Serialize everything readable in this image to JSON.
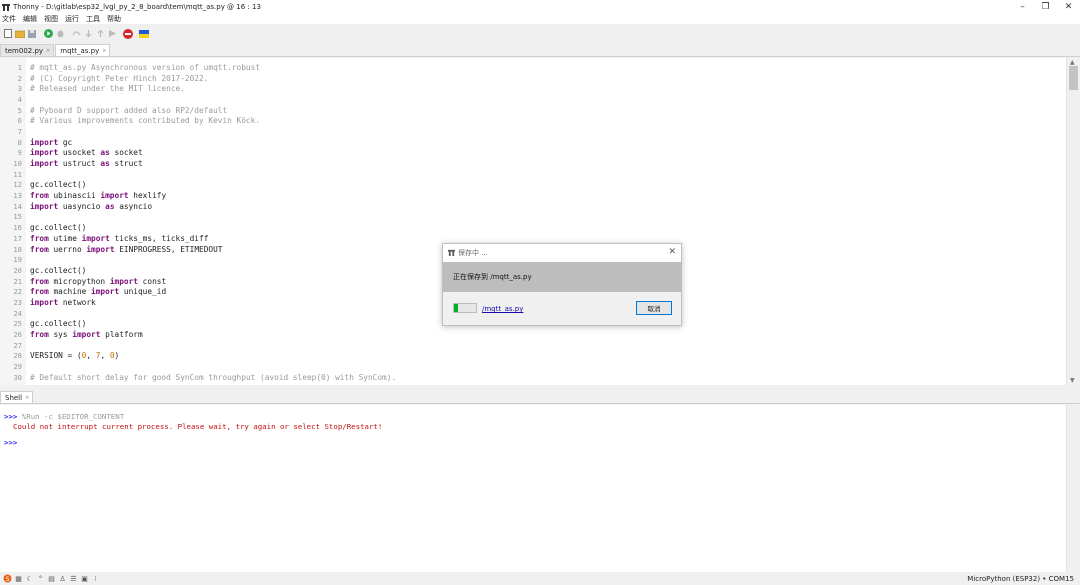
{
  "window": {
    "title": "Thonny  -  D:\\gitlab\\esp32_lvgl_py_2_8_board\\tem\\mqtt_as.py  @  16 : 13",
    "minimize": "–",
    "maximize": "❐",
    "close": "✕"
  },
  "menu": [
    "文件",
    "编辑",
    "视图",
    "运行",
    "工具",
    "帮助"
  ],
  "tabs": [
    {
      "label": "tem002.py",
      "close": "×"
    },
    {
      "label": "mqtt_as.py",
      "close": "×"
    }
  ],
  "editor": {
    "lines": [
      {
        "n": "1",
        "t": "# mqtt_as.py Asynchronous version of umqtt.robust"
      },
      {
        "n": "2",
        "t": "# (C) Copyright Peter Hinch 2017-2022."
      },
      {
        "n": "3",
        "t": "# Released under the MIT licence."
      },
      {
        "n": "4",
        "t": ""
      },
      {
        "n": "5",
        "t": "# Pyboard D support added also RP2/default"
      },
      {
        "n": "6",
        "t": "# Various improvements contributed by Kevin Köck."
      },
      {
        "n": "7",
        "t": ""
      },
      {
        "n": "8",
        "t": "import gc"
      },
      {
        "n": "9",
        "t": "import usocket as socket"
      },
      {
        "n": "10",
        "t": "import ustruct as struct"
      },
      {
        "n": "11",
        "t": ""
      },
      {
        "n": "12",
        "t": "gc.collect()"
      },
      {
        "n": "13",
        "t": "from ubinascii import hexlify"
      },
      {
        "n": "14",
        "t": "import uasyncio as asyncio"
      },
      {
        "n": "15",
        "t": ""
      },
      {
        "n": "16",
        "t": "gc.collect()"
      },
      {
        "n": "17",
        "t": "from utime import ticks_ms, ticks_diff"
      },
      {
        "n": "18",
        "t": "from uerrno import EINPROGRESS, ETIMEDOUT"
      },
      {
        "n": "19",
        "t": ""
      },
      {
        "n": "20",
        "t": "gc.collect()"
      },
      {
        "n": "21",
        "t": "from micropython import const"
      },
      {
        "n": "22",
        "t": "from machine import unique_id"
      },
      {
        "n": "23",
        "t": "import network"
      },
      {
        "n": "24",
        "t": ""
      },
      {
        "n": "25",
        "t": "gc.collect()"
      },
      {
        "n": "26",
        "t": "from sys import platform"
      },
      {
        "n": "27",
        "t": ""
      },
      {
        "n": "28",
        "t": "VERSION = (0, 7, 0)"
      },
      {
        "n": "29",
        "t": ""
      },
      {
        "n": "30",
        "t": "# Default short delay for good SynCom throughput (avoid sleep(0) with SynCom)."
      }
    ]
  },
  "shell": {
    "tab_label": "Shell",
    "tab_close": "×",
    "prompt": ">>>",
    "command": " %Run -c $EDITOR_CONTENT",
    "error": "Could not interrupt current process. Please wait, try again or select Stop/Restart!"
  },
  "dialog": {
    "title": "保存中 ...",
    "message": "正在保存到 /mqtt_as.py",
    "file_link": "/mqtt_as.py",
    "cancel": "取消",
    "progress": 0.2
  },
  "status": {
    "interpreter": "MicroPython (ESP32)  •  COM15"
  },
  "colors": {
    "comment": "#9a9a9a",
    "keyword": "#7a0e78",
    "number": "#c07000",
    "error": "#c21212",
    "prompt": "#2b2bff",
    "progress": "#06b025"
  }
}
